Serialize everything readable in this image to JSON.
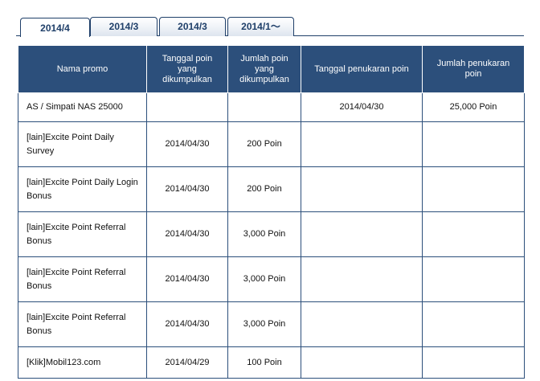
{
  "tabs": [
    {
      "label": "2014/4"
    },
    {
      "label": "2014/3"
    },
    {
      "label": "2014/3"
    },
    {
      "label": "2014/1〜"
    }
  ],
  "table": {
    "headers": {
      "promo_name": "Nama promo",
      "collected_date": "Tanggal poin yang dikumpulkan",
      "collected_amount": "Jumlah poin yang dikumpulkan",
      "redeem_date": "Tanggal penukaran poin",
      "redeem_amount": "Jumlah penukaran poin"
    },
    "rows": [
      {
        "name": "AS / Simpati NAS 25000",
        "collected_date": "",
        "collected_amount": "",
        "redeem_date": "2014/04/30",
        "redeem_amount": "25,000 Poin"
      },
      {
        "name": "[lain]Excite Point Daily Survey",
        "collected_date": "2014/04/30",
        "collected_amount": "200 Poin",
        "redeem_date": "",
        "redeem_amount": ""
      },
      {
        "name": "[lain]Excite Point Daily Login Bonus",
        "collected_date": "2014/04/30",
        "collected_amount": "200 Poin",
        "redeem_date": "",
        "redeem_amount": ""
      },
      {
        "name": "[lain]Excite Point Referral Bonus",
        "collected_date": "2014/04/30",
        "collected_amount": "3,000 Poin",
        "redeem_date": "",
        "redeem_amount": ""
      },
      {
        "name": "[lain]Excite Point Referral Bonus",
        "collected_date": "2014/04/30",
        "collected_amount": "3,000 Poin",
        "redeem_date": "",
        "redeem_amount": ""
      },
      {
        "name": "[lain]Excite Point Referral Bonus",
        "collected_date": "2014/04/30",
        "collected_amount": "3,000 Poin",
        "redeem_date": "",
        "redeem_amount": ""
      },
      {
        "name": "[Klik]Mobil123.com",
        "collected_date": "2014/04/29",
        "collected_amount": "100 Poin",
        "redeem_date": "",
        "redeem_amount": ""
      }
    ]
  },
  "colors": {
    "header_bg": "#2c4f7b",
    "tab_text": "#1f3f69",
    "border": "#2c4f7b"
  }
}
